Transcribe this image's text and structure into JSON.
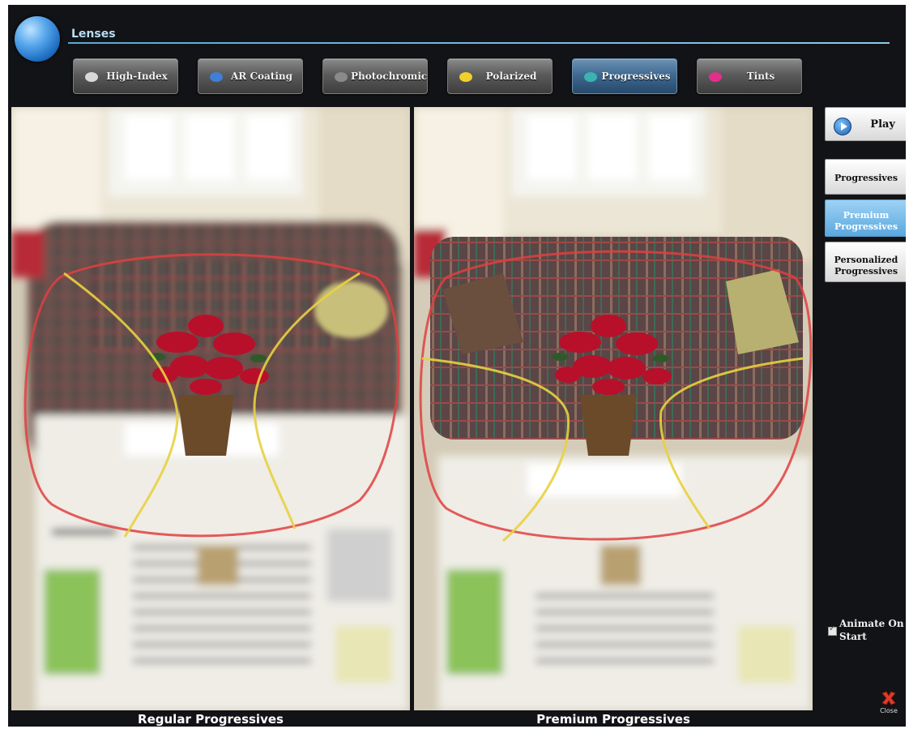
{
  "header": {
    "title": "Lenses"
  },
  "tabs": [
    {
      "label": "High-Index",
      "icon": "high-index-icon",
      "color": "#d8d8d8",
      "active": false
    },
    {
      "label": "AR Coating",
      "icon": "ar-coating-icon",
      "color": "#3f7fd6",
      "active": false
    },
    {
      "label": "Photochromic",
      "icon": "photochromic-icon",
      "color": "#8a8a8a",
      "active": false
    },
    {
      "label": "Polarized",
      "icon": "polarized-icon",
      "color": "#f0d02a",
      "active": false
    },
    {
      "label": "Progressives",
      "icon": "progressives-icon",
      "color": "#3bb3b0",
      "active": true
    },
    {
      "label": "Tints",
      "icon": "tints-icon",
      "color": "#e0308a",
      "active": false
    }
  ],
  "sidebar": {
    "play_label": "Play",
    "options": [
      {
        "label": "Progressives",
        "selected": false
      },
      {
        "label": "Premium Progressives",
        "selected": true
      },
      {
        "label": "Personalized Progressives",
        "selected": false
      }
    ],
    "animate_label": "Animate On Start",
    "animate_checked": true,
    "close_label": "Close"
  },
  "panels": {
    "left_caption": "Regular Progressives",
    "right_caption": "Premium Progressives"
  },
  "colors": {
    "accent": "#5ba9d6",
    "lens_outline": "#e04040",
    "focus_zone": "#e8d040",
    "active_tab": "#3f6a92",
    "selected_option": "#7fbde8"
  }
}
